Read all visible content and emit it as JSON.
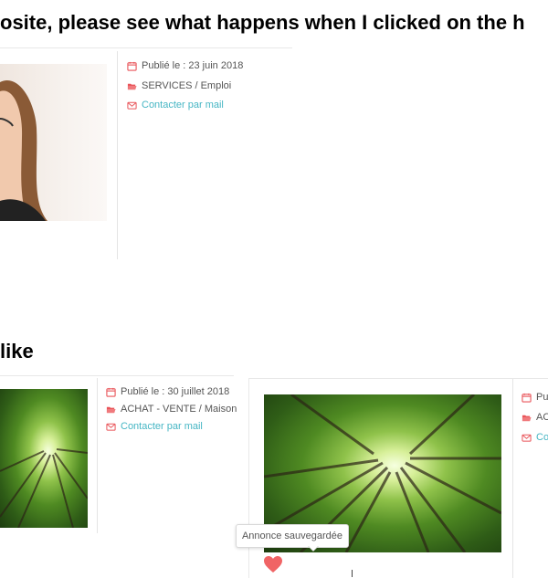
{
  "headings": {
    "top": "osite, please see what happens when I clicked on the h",
    "like": " like"
  },
  "card1": {
    "date": "Publié le : 23 juin 2018",
    "category": "SERVICES / Emploi",
    "contact": "Contacter par mail"
  },
  "card2": {
    "date": "Publié le : 30 juillet 2018",
    "category": "ACHAT - VENTE / Maison",
    "contact": "Contacter par mail"
  },
  "card3": {
    "date": "Pu",
    "category": "AC",
    "contact": "Co"
  },
  "tooltip": "Annonce sauvegardée",
  "colors": {
    "icon_red": "#e9555a",
    "link_teal": "#46b6c4",
    "heart": "#f06465"
  },
  "icons": [
    "calendar-icon",
    "folder-icon",
    "envelope-icon",
    "heart-icon"
  ]
}
